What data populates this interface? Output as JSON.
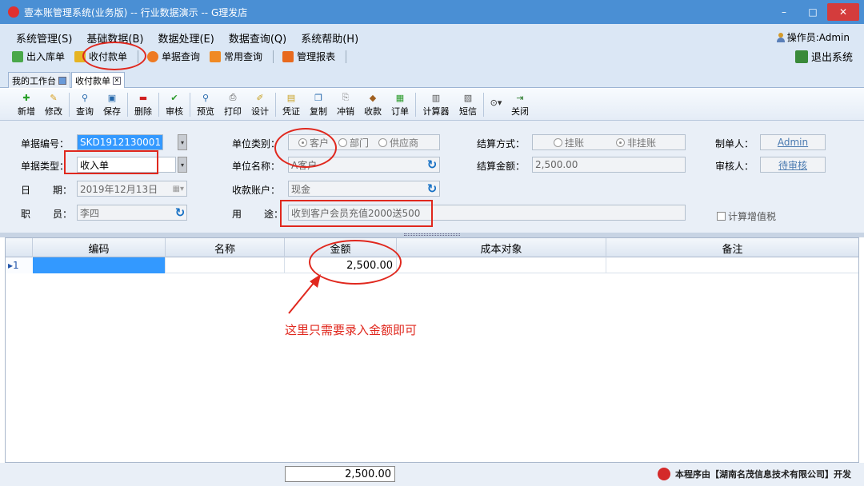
{
  "window": {
    "title": "壹本账管理系统(业务版) -- 行业数据演示 -- G理发店",
    "minimize": "–",
    "maximize": "□",
    "close": "✕"
  },
  "menu": [
    "系统管理(S)",
    "基础数据(B)",
    "数据处理(E)",
    "数据查询(Q)",
    "系统帮助(H)"
  ],
  "operator": "操作员:Admin",
  "quickbar": {
    "items": [
      "出入库单",
      "收付款单",
      "单据查询",
      "常用查询",
      "管理报表"
    ],
    "exit": "退出系统"
  },
  "tabs": [
    "我的工作台",
    "收付款单"
  ],
  "toolbar": [
    "新增",
    "修改",
    "查询",
    "保存",
    "删除",
    "审核",
    "预览",
    "打印",
    "设计",
    "凭证",
    "复制",
    "冲销",
    "收款",
    "订单",
    "计算器",
    "短信",
    "关闭"
  ],
  "form": {
    "doc_no_label": "单据编号：",
    "doc_no": "SKD1912130001",
    "doc_type_label": "单据类型：",
    "doc_type": "收入单",
    "date_label_a": "日",
    "date_label_b": "期：",
    "date": "2019年12月13日",
    "staff_label_a": "职",
    "staff_label_b": "员：",
    "staff": "李四",
    "unit_type_label": "单位类别：",
    "unit_type_options": [
      "客户",
      "部门",
      "供应商"
    ],
    "unit_name_label": "单位名称：",
    "unit_name": "A客户",
    "account_label": "收款账户：",
    "account": "现金",
    "purpose_label_a": "用",
    "purpose_label_b": "途：",
    "purpose": "收到客户会员充值2000送500",
    "settle_method_label": "结算方式：",
    "settle_options": [
      "挂账",
      "非挂账"
    ],
    "settle_amount_label": "结算金额：",
    "settle_amount": "2,500.00",
    "maker_label": "制单人：",
    "maker": "Admin",
    "auditor_label": "审核人：",
    "auditor": "待审核",
    "vat_label": "计算增值税"
  },
  "grid": {
    "columns": [
      "编码",
      "名称",
      "金额",
      "成本对象",
      "备注"
    ],
    "rows": [
      {
        "index": "1",
        "code": "",
        "name": "",
        "amount": "2,500.00",
        "cost_object": "",
        "note": ""
      }
    ],
    "total": "2,500.00"
  },
  "annotation": "这里只需要录入金额即可",
  "credit": "本程序由【湖南名茂信息技术有限公司】开发",
  "colors": {
    "accent": "#4a8fd4",
    "annotation": "#e0281e",
    "selection": "#3399ff"
  }
}
